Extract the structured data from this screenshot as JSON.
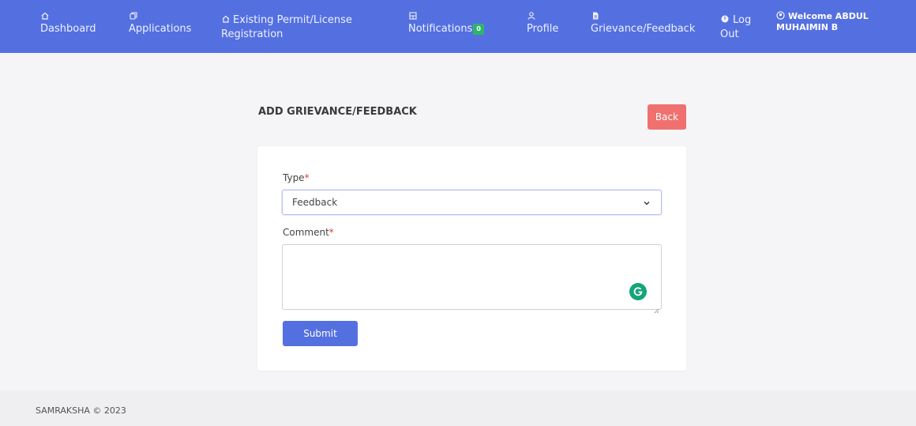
{
  "nav": {
    "items": [
      {
        "label": "Dashboard",
        "icon": "home-icon"
      },
      {
        "label": "Applications",
        "icon": "copy-icon"
      },
      {
        "label_line1": "Existing Permit/License",
        "label_line2": "Registration",
        "icon": "home-icon"
      },
      {
        "label": "Notifications",
        "badge": "0",
        "icon": "grid-icon"
      },
      {
        "label": "Profile",
        "icon": "user-icon"
      },
      {
        "label": "Grievance/Feedback",
        "icon": "document-icon"
      },
      {
        "label_line1": "Log",
        "label_line2": "Out",
        "icon": "power-icon"
      }
    ],
    "welcome_line1": "Welcome ABDUL",
    "welcome_line2": "MUHAIMIN B"
  },
  "page": {
    "title": "ADD GRIEVANCE/FEEDBACK",
    "back_label": "Back"
  },
  "form": {
    "type_label": "Type",
    "required_mark": "*",
    "type_value": "Feedback",
    "comment_label": "Comment",
    "comment_value": "",
    "submit_label": "Submit"
  },
  "footer": {
    "text": "SAMRAKSHA © 2023"
  },
  "colors": {
    "nav_bg": "#5470e0",
    "back_button": "#f07070",
    "submit_button": "#5470e0",
    "badge": "#2fb56a",
    "required": "#e23b3b"
  }
}
